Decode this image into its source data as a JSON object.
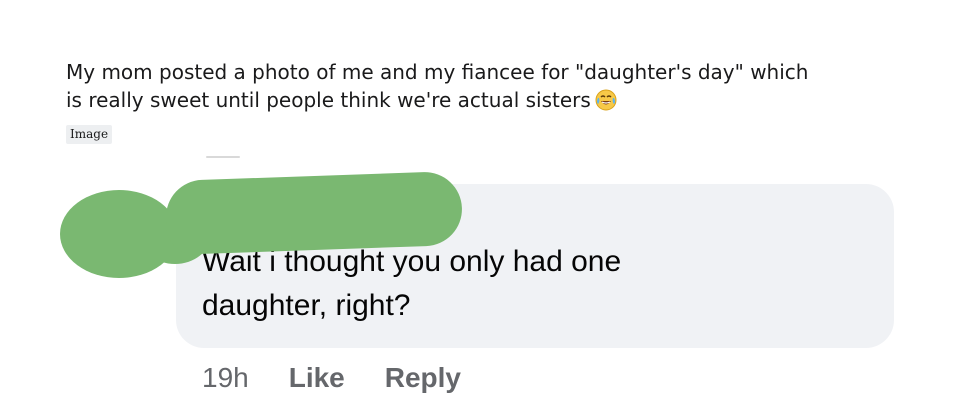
{
  "post": {
    "title_line1": "My mom posted a photo of me and my fiancee for \"daughter's day\" which",
    "title_line2": "is really sweet until people think we're actual sisters",
    "title_emoji_icon": "crying-laughing-emoji-icon",
    "flair": "Image"
  },
  "comment": {
    "text_line1": "Wait i thought you only had one",
    "text_line2": "daughter, right?",
    "time": "19h",
    "like_label": "Like",
    "reply_label": "Reply",
    "redaction_color": "#7ab871",
    "bubble_color": "#f0f2f5"
  }
}
